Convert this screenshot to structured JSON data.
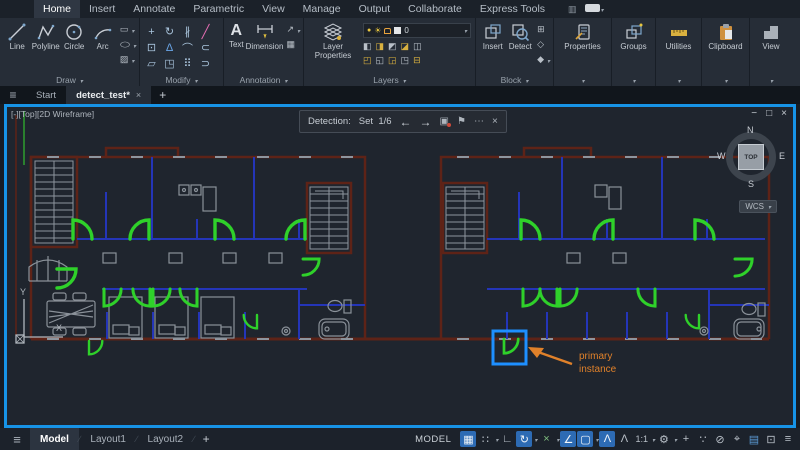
{
  "colors": {
    "selection_blue": "#1793e6",
    "detect_green": "#2fd12a",
    "wall_red": "#5e2317",
    "partition_blue": "#2435b8",
    "callout_orange": "#e0812a",
    "active_icon_blue": "#2d6bb4"
  },
  "icons": {
    "hamburger": "≡",
    "close": "×",
    "plus": "+",
    "minimize": "−",
    "restore": "□"
  },
  "menubar": {
    "tabs": [
      "Home",
      "Insert",
      "Annotate",
      "Parametric",
      "View",
      "Manage",
      "Output",
      "Collaborate",
      "Express Tools"
    ],
    "active": "Home"
  },
  "ribbon": {
    "draw": {
      "title": "Draw",
      "line": "Line",
      "polyline": "Polyline",
      "circle": "Circle",
      "arc": "Arc",
      "extra_glyphs": [
        "▭",
        "◯",
        "▨"
      ]
    },
    "modify": {
      "title": "Modify",
      "icons": [
        "+",
        "↻",
        "∦",
        "╱",
        "⊡",
        "Δ",
        "⌒",
        "⊂",
        "▱",
        "◳",
        "⠿",
        "⊃"
      ]
    },
    "annotation": {
      "title": "Annotation",
      "text": "Text",
      "dimension": "Dimension",
      "extra_glyphs": [
        "↗",
        "▦"
      ]
    },
    "layers": {
      "title": "Layers",
      "button": "Layer Properties",
      "current_layer": "0",
      "tool_glyphs": [
        "◧",
        "◨",
        "◩",
        "◪",
        "◫",
        "◰",
        "◱",
        "◲",
        "◳",
        "⊟"
      ]
    },
    "block": {
      "title": "Block",
      "insert": "Insert",
      "detect": "Detect",
      "extra_glyphs": [
        "⊞",
        "◇",
        "◆"
      ]
    },
    "right_panels": [
      "Properties",
      "Groups",
      "Utilities",
      "Clipboard",
      "View"
    ]
  },
  "filetabs": {
    "start": "Start",
    "drawing": "detect_test*"
  },
  "canvas": {
    "viewport_label": "[-][Top][2D Wireframe]",
    "detection": {
      "label": "Detection:",
      "set": "Set",
      "count": "1/6",
      "prev": "←",
      "next": "→",
      "redefine": "▣",
      "flag": "⚑",
      "more": "⋯",
      "close": "×"
    },
    "viewcube": {
      "n": "N",
      "s": "S",
      "e": "E",
      "w": "W",
      "top": "TOP",
      "wcs": "WCS"
    },
    "ucs": {
      "x": "X",
      "y": "Y"
    },
    "callout": {
      "line1": "primary",
      "line2": "instance"
    }
  },
  "statusbar": {
    "model_tab": "Model",
    "layout1": "Layout1",
    "layout2": "Layout2",
    "model_badge": "MODEL",
    "scale": "1:1",
    "icons": [
      {
        "name": "grid-icon",
        "glyph": "▦"
      },
      {
        "name": "snap-icon",
        "glyph": "∷"
      },
      {
        "name": "ortho-icon",
        "glyph": "∟"
      },
      {
        "name": "polar-icon",
        "glyph": "↻"
      },
      {
        "name": "isodraft-icon",
        "glyph": "×"
      },
      {
        "name": "otrack-icon",
        "glyph": "∠"
      },
      {
        "name": "osnap-icon",
        "glyph": "▢"
      },
      {
        "name": "annot-visibility-icon",
        "glyph": "Λ"
      },
      {
        "name": "annot-autoscale-icon",
        "glyph": "Λ"
      },
      {
        "name": "workspace-gear-icon",
        "glyph": "⚙"
      },
      {
        "name": "move-icon",
        "glyph": "+"
      },
      {
        "name": "isolate-icon",
        "glyph": "∵"
      },
      {
        "name": "hardware-icon",
        "glyph": "⊘"
      },
      {
        "name": "annotation-monitor-icon",
        "glyph": "⌖"
      },
      {
        "name": "graphics-icon",
        "glyph": "▤"
      },
      {
        "name": "clean-screen-icon",
        "glyph": "⊡"
      },
      {
        "name": "customize-icon",
        "glyph": "≡"
      }
    ]
  }
}
